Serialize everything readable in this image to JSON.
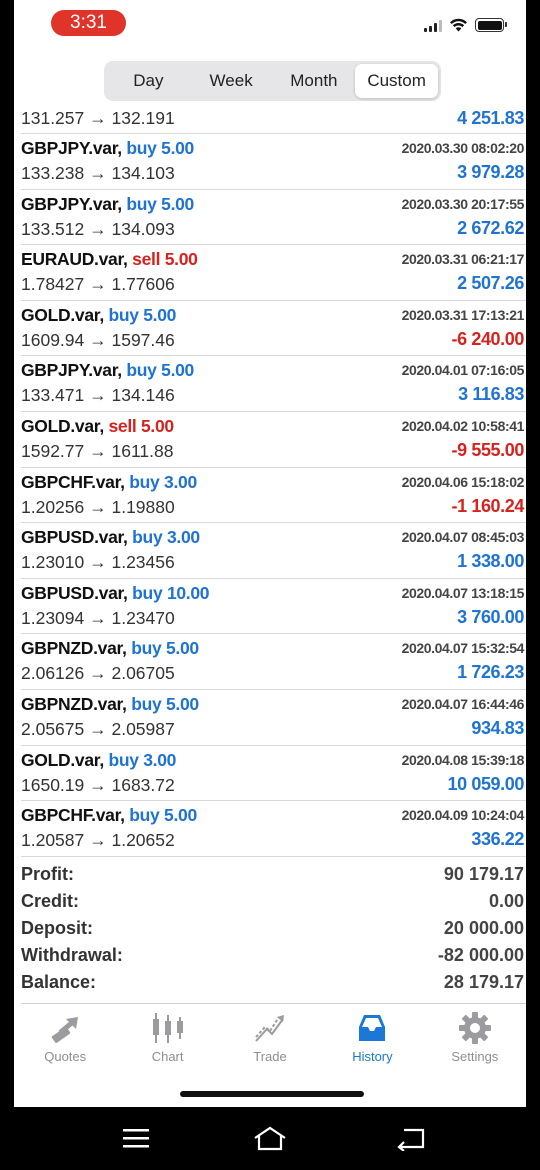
{
  "status": {
    "time": "3:31"
  },
  "segments": [
    {
      "label": "Day",
      "active": false
    },
    {
      "label": "Week",
      "active": false
    },
    {
      "label": "Month",
      "active": false
    },
    {
      "label": "Custom",
      "active": true
    }
  ],
  "first_row": {
    "prices": "131.257 → 132.191",
    "profit": "4 251.83"
  },
  "trades": [
    {
      "symbol": "GBPJPY.var,",
      "side": "buy",
      "side_text": "buy 5.00",
      "prices": "133.238 → 134.103",
      "date": "2020.03.30 08:02:20",
      "profit": "3 979.28",
      "sign": "pos"
    },
    {
      "symbol": "GBPJPY.var,",
      "side": "buy",
      "side_text": "buy 5.00",
      "prices": "133.512 → 134.093",
      "date": "2020.03.30 20:17:55",
      "profit": "2 672.62",
      "sign": "pos"
    },
    {
      "symbol": "EURAUD.var,",
      "side": "sell",
      "side_text": "sell 5.00",
      "prices": "1.78427 → 1.77606",
      "date": "2020.03.31 06:21:17",
      "profit": "2 507.26",
      "sign": "pos"
    },
    {
      "symbol": "GOLD.var,",
      "side": "buy",
      "side_text": "buy 5.00",
      "prices": "1609.94 → 1597.46",
      "date": "2020.03.31 17:13:21",
      "profit": "-6 240.00",
      "sign": "neg"
    },
    {
      "symbol": "GBPJPY.var,",
      "side": "buy",
      "side_text": "buy 5.00",
      "prices": "133.471 → 134.146",
      "date": "2020.04.01 07:16:05",
      "profit": "3 116.83",
      "sign": "pos"
    },
    {
      "symbol": "GOLD.var,",
      "side": "sell",
      "side_text": "sell 5.00",
      "prices": "1592.77 → 1611.88",
      "date": "2020.04.02 10:58:41",
      "profit": "-9 555.00",
      "sign": "neg"
    },
    {
      "symbol": "GBPCHF.var,",
      "side": "buy",
      "side_text": "buy 3.00",
      "prices": "1.20256 → 1.19880",
      "date": "2020.04.06 15:18:02",
      "profit": "-1 160.24",
      "sign": "neg"
    },
    {
      "symbol": "GBPUSD.var,",
      "side": "buy",
      "side_text": "buy 3.00",
      "prices": "1.23010 → 1.23456",
      "date": "2020.04.07 08:45:03",
      "profit": "1 338.00",
      "sign": "pos"
    },
    {
      "symbol": "GBPUSD.var,",
      "side": "buy",
      "side_text": "buy 10.00",
      "prices": "1.23094 → 1.23470",
      "date": "2020.04.07 13:18:15",
      "profit": "3 760.00",
      "sign": "pos"
    },
    {
      "symbol": "GBPNZD.var,",
      "side": "buy",
      "side_text": "buy 5.00",
      "prices": "2.06126 → 2.06705",
      "date": "2020.04.07 15:32:54",
      "profit": "1 726.23",
      "sign": "pos"
    },
    {
      "symbol": "GBPNZD.var,",
      "side": "buy",
      "side_text": "buy 5.00",
      "prices": "2.05675 → 2.05987",
      "date": "2020.04.07 16:44:46",
      "profit": "934.83",
      "sign": "pos"
    },
    {
      "symbol": "GOLD.var,",
      "side": "buy",
      "side_text": "buy 3.00",
      "prices": "1650.19 → 1683.72",
      "date": "2020.04.08 15:39:18",
      "profit": "10 059.00",
      "sign": "pos"
    },
    {
      "symbol": "GBPCHF.var,",
      "side": "buy",
      "side_text": "buy 5.00",
      "prices": "1.20587 → 1.20652",
      "date": "2020.04.09 10:24:04",
      "profit": "336.22",
      "sign": "pos"
    }
  ],
  "summary": [
    {
      "label": "Profit:",
      "value": "90 179.17"
    },
    {
      "label": "Credit:",
      "value": "0.00"
    },
    {
      "label": "Deposit:",
      "value": "20 000.00"
    },
    {
      "label": "Withdrawal:",
      "value": "-82 000.00"
    },
    {
      "label": "Balance:",
      "value": "28 179.17"
    }
  ],
  "tabs": [
    {
      "label": "Quotes",
      "icon": "quotes-icon",
      "active": false
    },
    {
      "label": "Chart",
      "icon": "chart-icon",
      "active": false
    },
    {
      "label": "Trade",
      "icon": "trade-icon",
      "active": false
    },
    {
      "label": "History",
      "icon": "history-icon",
      "active": true
    },
    {
      "label": "Settings",
      "icon": "gear-icon",
      "active": false
    }
  ],
  "colors": {
    "buy": "#1f73d2",
    "sell": "#d7231e",
    "active_tab": "#1b78d6",
    "time_pill": "#e0332a"
  }
}
